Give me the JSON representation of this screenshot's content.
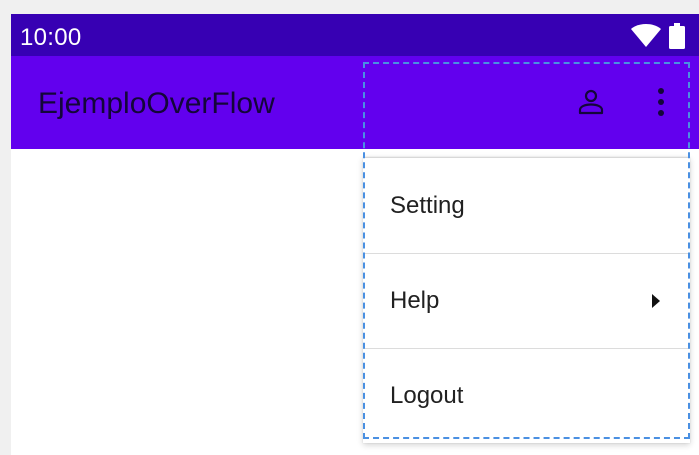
{
  "status_bar": {
    "time": "10:00",
    "icons": [
      "wifi-icon",
      "battery-icon"
    ],
    "color": "#3700b3"
  },
  "app_bar": {
    "title": "EjemploOverFlow",
    "color": "#6200ee",
    "actions": [
      "account-icon",
      "overflow-menu-icon"
    ]
  },
  "overflow_menu": {
    "items": [
      {
        "label": "Setting",
        "has_submenu": false
      },
      {
        "label": "Help",
        "has_submenu": true,
        "submenu_icon": "chevron-right-icon"
      },
      {
        "label": "Logout",
        "has_submenu": false
      }
    ]
  },
  "selection_highlight": {
    "color": "#4a90e2",
    "style": "dashed"
  }
}
